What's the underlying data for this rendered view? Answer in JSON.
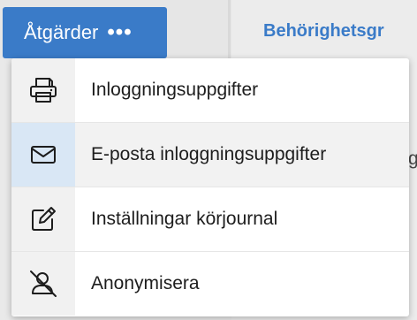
{
  "toolbar": {
    "actions_label": "Åtgärder",
    "actions_more": "•••",
    "tab_label": "Behörighetsgr"
  },
  "menu": {
    "items": [
      {
        "label": "Inloggningsuppgifter",
        "icon": "printer-icon"
      },
      {
        "label": "E-posta inloggningsuppgifter",
        "icon": "envelope-icon",
        "highlighted": true
      },
      {
        "label": "Inställningar körjournal",
        "icon": "pencil-square-icon"
      },
      {
        "label": "Anonymisera",
        "icon": "user-slash-icon"
      }
    ]
  },
  "colors": {
    "accent": "#3a7bc8",
    "highlight_icon_bg": "#d9e7f5",
    "highlight_row_bg": "#f2f2f2"
  }
}
